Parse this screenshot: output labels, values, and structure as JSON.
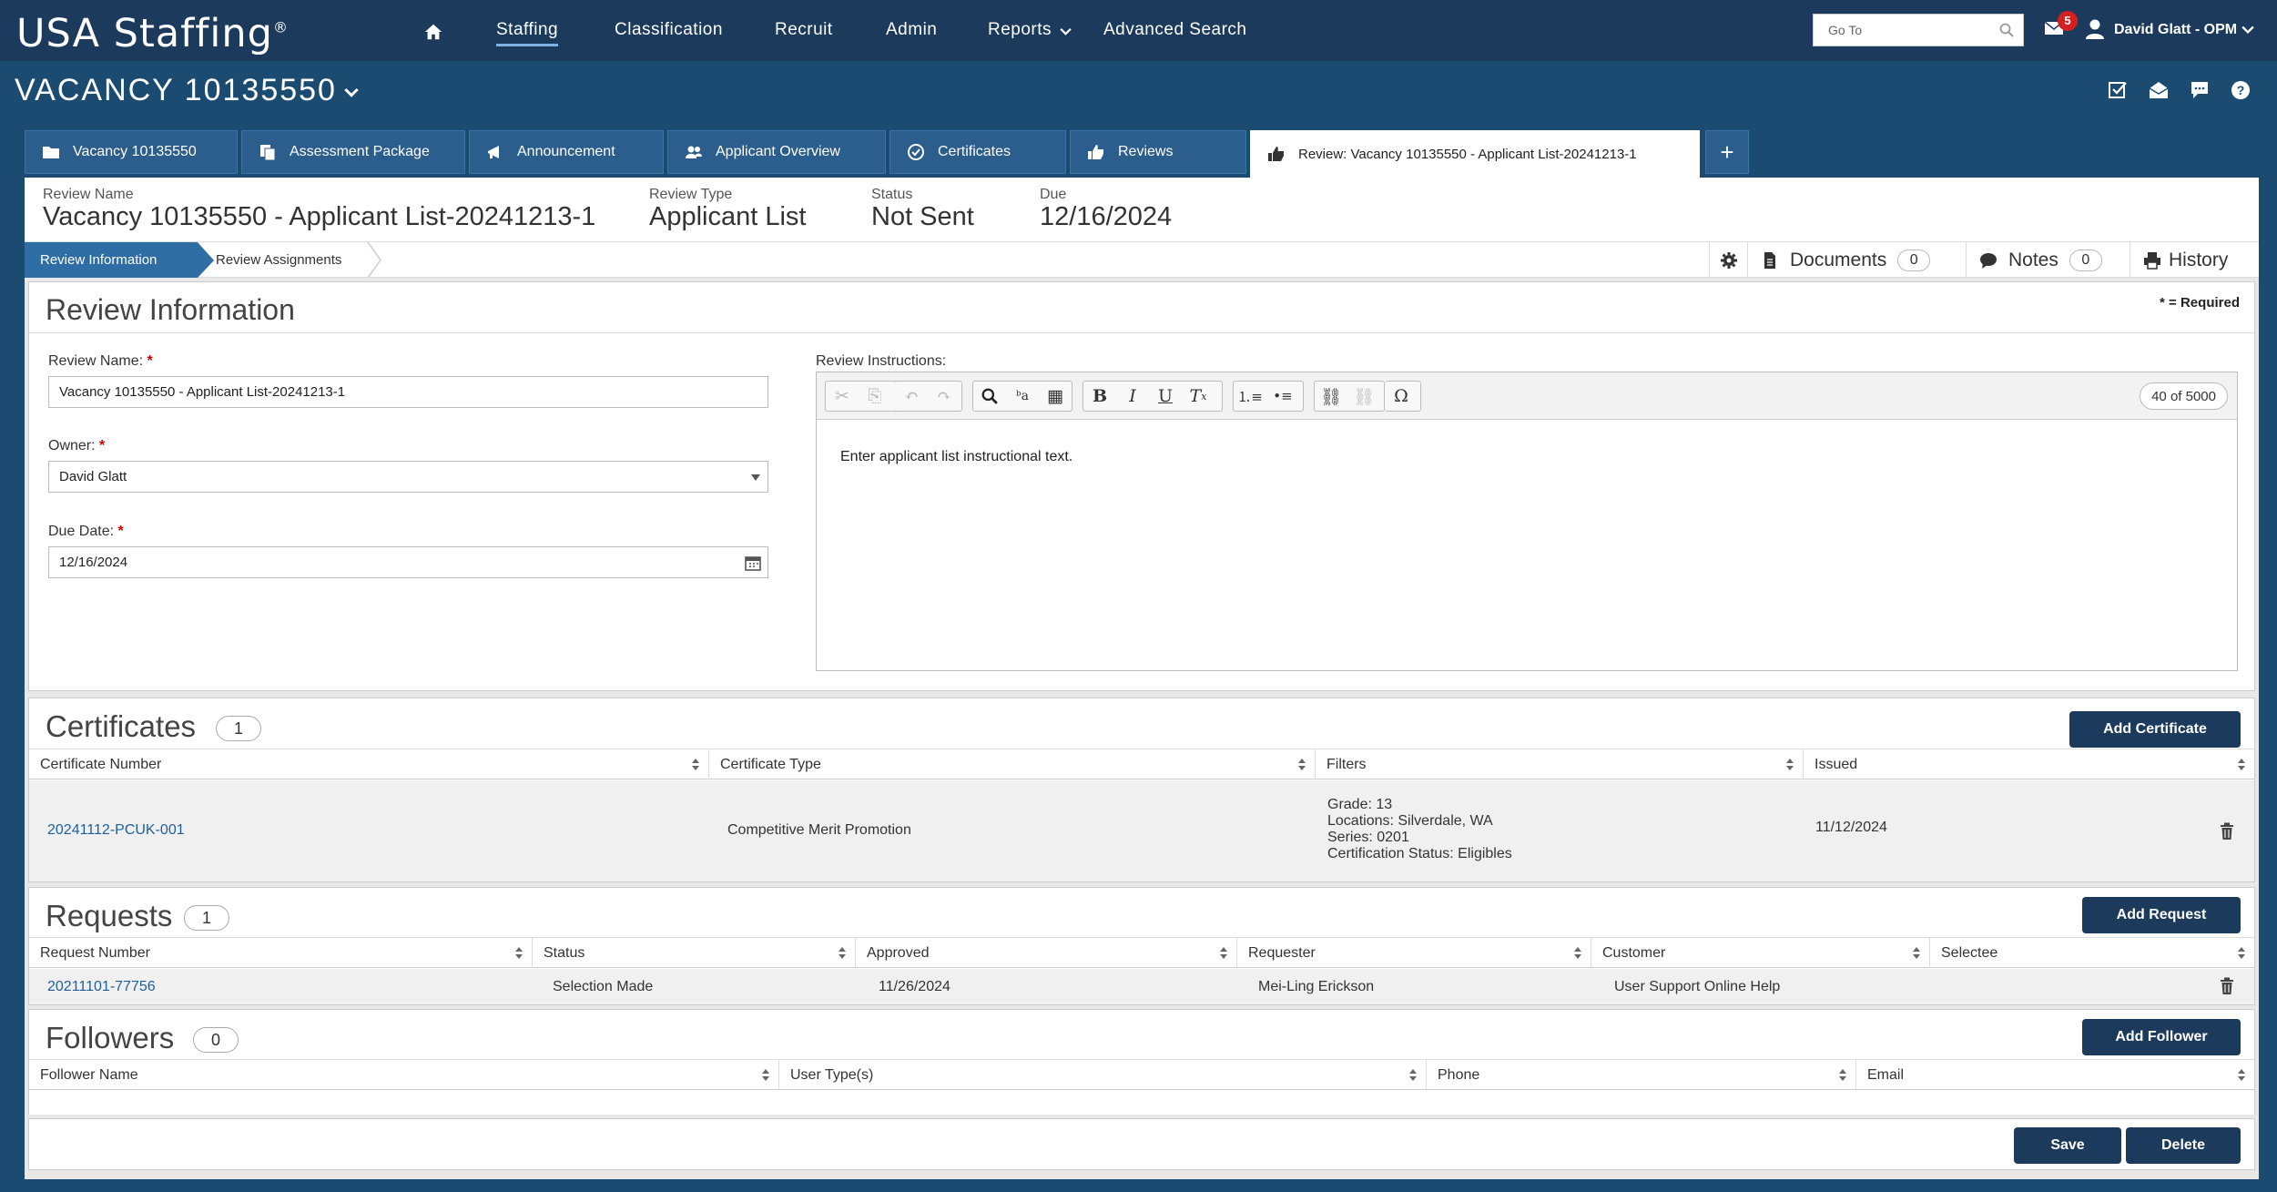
{
  "topbar": {
    "brand": "USA Staffing",
    "brand_mark": "®",
    "nav": [
      "Staffing",
      "Classification",
      "Recruit",
      "Admin",
      "Reports",
      "Advanced Search"
    ],
    "goto_placeholder": "Go To",
    "mail_count": "5",
    "user_name": "David Glatt - OPM"
  },
  "vacancy": {
    "title": "VACANCY 10135550"
  },
  "tabs": [
    {
      "label": "Vacancy 10135550",
      "icon": "folder-icon"
    },
    {
      "label": "Assessment Package",
      "icon": "documents-icon"
    },
    {
      "label": "Announcement",
      "icon": "megaphone-icon"
    },
    {
      "label": "Applicant Overview",
      "icon": "users-icon"
    },
    {
      "label": "Certificates",
      "icon": "check-circle-icon"
    },
    {
      "label": "Reviews",
      "icon": "thumbs-up-icon"
    },
    {
      "label": "Review: Vacancy 10135550 - Applicant List-20241213-1",
      "icon": "thumbs-up-icon"
    }
  ],
  "summary": {
    "name_label": "Review Name",
    "name_value": "Vacancy 10135550 - Applicant List-20241213-1",
    "type_label": "Review Type",
    "type_value": "Applicant List",
    "status_label": "Status",
    "status_value": "Not Sent",
    "due_label": "Due",
    "due_value": "12/16/2024"
  },
  "subnav": {
    "active": "Review Information",
    "second": "Review Assignments",
    "documents_label": "Documents",
    "documents_count": "0",
    "notes_label": "Notes",
    "notes_count": "0",
    "history_label": "History"
  },
  "review_info": {
    "title": "Review Information",
    "required_note": "* = Required",
    "name_label": "Review Name:",
    "name_value": "Vacancy 10135550 - Applicant List-20241213-1",
    "owner_label": "Owner:",
    "owner_value": "David Glatt",
    "due_label": "Due Date:",
    "due_value": "12/16/2024",
    "instructions_label": "Review Instructions:",
    "char_count": "40 of 5000",
    "instructions_text": "Enter applicant list instructional text."
  },
  "certificates": {
    "title": "Certificates",
    "count": "1",
    "add_label": "Add Certificate",
    "columns": [
      "Certificate Number",
      "Certificate Type",
      "Filters",
      "Issued"
    ],
    "rows": [
      {
        "number": "20241112-PCUK-001",
        "type": "Competitive Merit Promotion",
        "filters": [
          "Grade: 13",
          "Locations: Silverdale, WA",
          "Series: 0201",
          "Certification Status: Eligibles"
        ],
        "issued": "11/12/2024"
      }
    ]
  },
  "requests": {
    "title": "Requests",
    "count": "1",
    "add_label": "Add Request",
    "columns": [
      "Request Number",
      "Status",
      "Approved",
      "Requester",
      "Customer",
      "Selectee"
    ],
    "rows": [
      {
        "number": "20211101-77756",
        "status": "Selection Made",
        "approved": "11/26/2024",
        "requester": "Mei-Ling Erickson",
        "customer": "User Support Online Help",
        "selectee": ""
      }
    ]
  },
  "followers": {
    "title": "Followers",
    "count": "0",
    "add_label": "Add Follower",
    "columns": [
      "Follower Name",
      "User Type(s)",
      "Phone",
      "Email"
    ]
  },
  "footer": {
    "save_label": "Save",
    "delete_label": "Delete"
  }
}
